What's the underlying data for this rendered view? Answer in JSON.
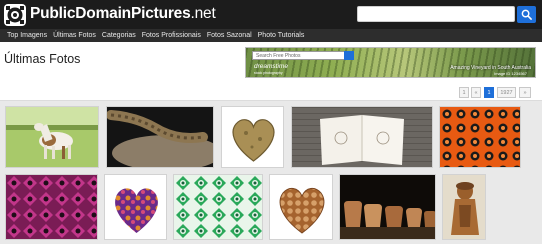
{
  "header": {
    "logo_bold": "PublicDomain",
    "logo_light": "Pictures",
    "logo_tld": ".net",
    "search_value": "",
    "search_placeholder": ""
  },
  "nav": {
    "items": [
      "Top Imagens",
      "Últimas Fotos",
      "Categorias",
      "Fotos Profissionais",
      "Fotos Sazonal",
      "Photo Tutorials"
    ]
  },
  "main": {
    "title": "Últimas Fotos"
  },
  "ad": {
    "search_placeholder": "Search Free Photos",
    "brand": "dreamstime",
    "brand_sub": "stock photography",
    "caption": "Amazing Vineyard in South Australia",
    "credit": "Image ID 1234567"
  },
  "pagination": {
    "first": "1",
    "prev": "«",
    "current": "1",
    "last": "1927",
    "next": "»"
  },
  "gallery": {
    "items": [
      {
        "name": "pony-photo"
      },
      {
        "name": "snake-photo"
      },
      {
        "name": "stone-heart-photo"
      },
      {
        "name": "open-book-photo"
      },
      {
        "name": "orange-pattern-photo"
      },
      {
        "name": "magenta-pattern-photo"
      },
      {
        "name": "floral-heart-photo"
      },
      {
        "name": "green-pattern-photo"
      },
      {
        "name": "crochet-heart-photo"
      },
      {
        "name": "pottery-photo"
      },
      {
        "name": "wood-carving-photo"
      }
    ]
  },
  "colors": {
    "header_bg": "#1c1c1c",
    "nav_bg": "#2d2d2d",
    "accent": "#1e6fd9"
  }
}
